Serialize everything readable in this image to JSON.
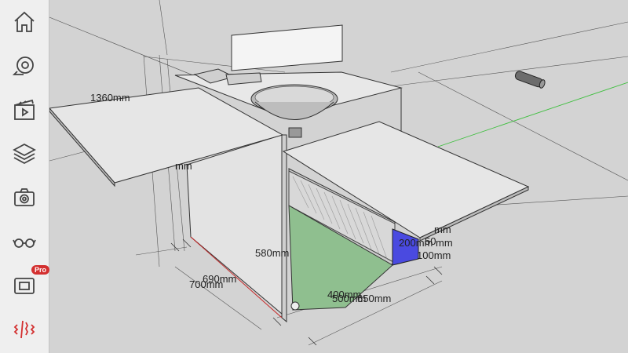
{
  "toolbar": {
    "items": [
      {
        "name": "home-icon",
        "label": "Home"
      },
      {
        "name": "tape-measure-icon",
        "label": "Tape measure"
      },
      {
        "name": "scenes-icon",
        "label": "Scenes"
      },
      {
        "name": "layers-icon",
        "label": "Layers"
      },
      {
        "name": "camera-icon",
        "label": "Camera"
      },
      {
        "name": "glasses-icon",
        "label": "View"
      },
      {
        "name": "ar-icon",
        "label": "AR",
        "badge": "Pro"
      },
      {
        "name": "section-plane-icon",
        "label": "Section"
      }
    ],
    "accent_color": "#d32f2f"
  },
  "dimensions": {
    "d1360": "1360mm",
    "d580": "580mm",
    "d690": "690mm",
    "d700": "700mm",
    "d200": "200mm",
    "d100": "100mm",
    "d400": "400mm",
    "d500": "500mm",
    "d650": "650mm",
    "partial_mm_left": "mm",
    "partial_mm_right": "mm",
    "partial_mm_mid": "mm",
    "partial_50": "50"
  },
  "colors": {
    "viewport_bg": "#d3d3d3",
    "floor_green": "#8fbf8f",
    "side_blue": "#4a4ae0",
    "axis_green": "#3fbf3f"
  }
}
